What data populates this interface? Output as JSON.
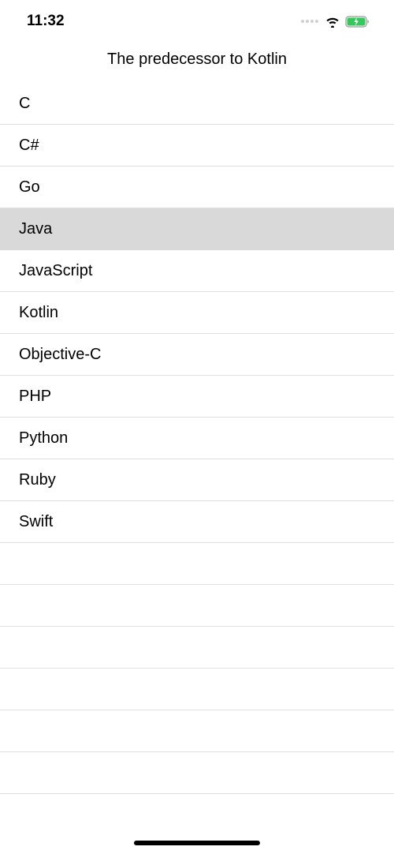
{
  "statusBar": {
    "time": "11:32"
  },
  "header": {
    "title": "The predecessor to Kotlin"
  },
  "list": {
    "items": [
      {
        "label": "C",
        "selected": false
      },
      {
        "label": "C#",
        "selected": false
      },
      {
        "label": "Go",
        "selected": false
      },
      {
        "label": "Java",
        "selected": true
      },
      {
        "label": "JavaScript",
        "selected": false
      },
      {
        "label": "Kotlin",
        "selected": false
      },
      {
        "label": "Objective-C",
        "selected": false
      },
      {
        "label": "PHP",
        "selected": false
      },
      {
        "label": "Python",
        "selected": false
      },
      {
        "label": "Ruby",
        "selected": false
      },
      {
        "label": "Swift",
        "selected": false
      }
    ],
    "emptyRows": 6
  }
}
